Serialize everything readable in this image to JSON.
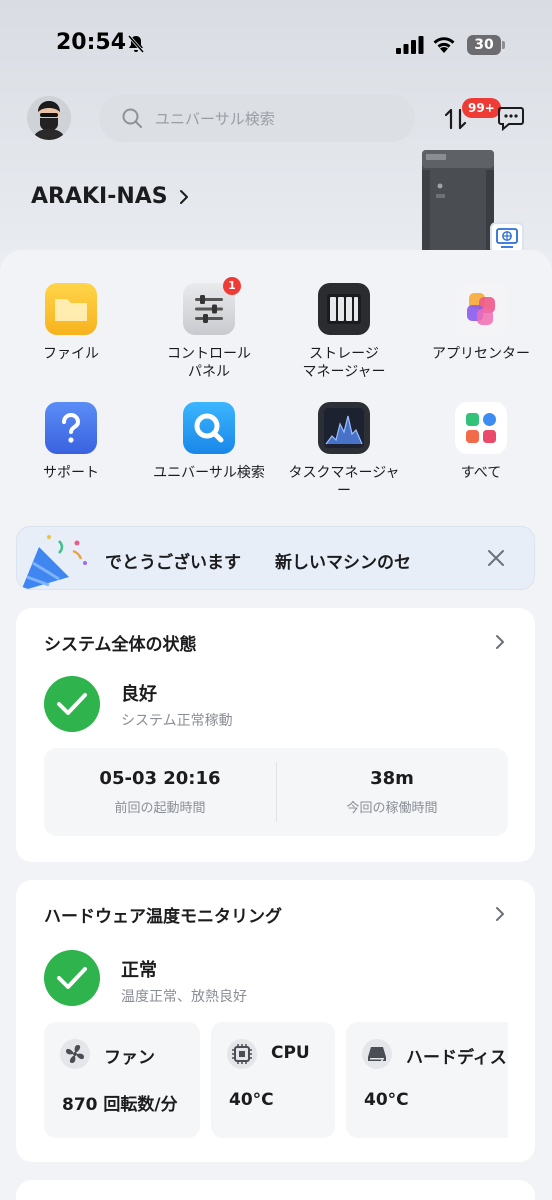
{
  "status_bar": {
    "time": "20:54",
    "battery": "30"
  },
  "header": {
    "search_placeholder": "ユニバーサル検索",
    "transfer_badge": "99+",
    "device_name": "ARAKI-NAS"
  },
  "apps": [
    {
      "label": "ファイル",
      "badge": ""
    },
    {
      "label": "コントロール\nパネル",
      "badge": "1"
    },
    {
      "label": "ストレージ\nマネージャー",
      "badge": ""
    },
    {
      "label": "アプリセンター",
      "badge": ""
    },
    {
      "label": "サポート",
      "badge": ""
    },
    {
      "label": "ユニバーサル検索",
      "badge": ""
    },
    {
      "label": "タスクマネージャ\nー",
      "badge": ""
    },
    {
      "label": "すべて",
      "badge": ""
    }
  ],
  "banner": {
    "text1": "でとうございます",
    "text2": "新しいマシンのセ"
  },
  "system_card": {
    "title": "システム全体の状態",
    "status": "良好",
    "status_sub": "システム正常稼動",
    "last_boot_value": "05-03 20:16",
    "last_boot_label": "前回の起動時間",
    "uptime_value": "38m",
    "uptime_label": "今回の稼働時間"
  },
  "hardware_card": {
    "title": "ハードウェア温度モニタリング",
    "status": "正常",
    "status_sub": "温度正常、放熱良好",
    "items": [
      {
        "name": "ファン",
        "value": "870 回転数/分"
      },
      {
        "name": "CPU",
        "value": "40°C"
      },
      {
        "name": "ハードディスク",
        "value": "40°C"
      }
    ]
  },
  "colors": {
    "accent_green": "#2eb34d",
    "badge_red": "#ef3b35"
  }
}
